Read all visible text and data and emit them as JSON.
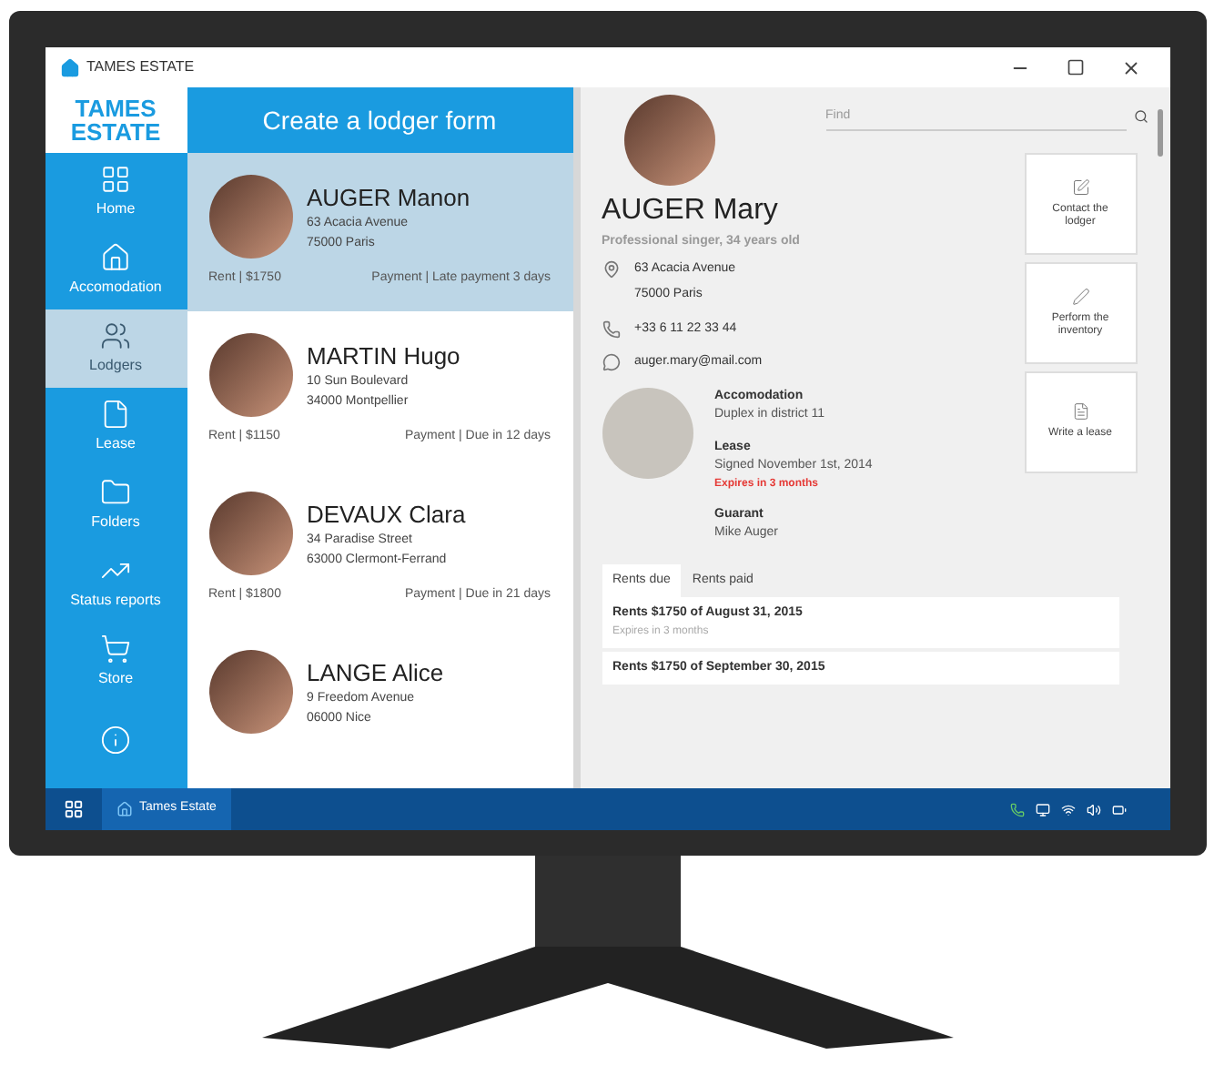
{
  "window": {
    "title": "TAMES ESTATE"
  },
  "logo": {
    "line_1": "TAMES",
    "line_2": "ESTATE"
  },
  "sidebar": {
    "items": [
      {
        "kind": "grid",
        "label": "Home",
        "selected": false
      },
      {
        "kind": "house",
        "label": "Accomodation",
        "selected": false
      },
      {
        "kind": "people",
        "label": "Lodgers",
        "selected": true
      },
      {
        "kind": "file",
        "label": "Lease",
        "selected": false
      },
      {
        "kind": "folder",
        "label": "Folders",
        "selected": false
      },
      {
        "kind": "chart",
        "label": "Status reports",
        "selected": false
      },
      {
        "kind": "cart",
        "label": "Store",
        "selected": false
      },
      {
        "kind": "info",
        "selected": false
      }
    ]
  },
  "list": {
    "header": "Create a lodger form",
    "lodgers": [
      {
        "name": "AUGER Manon",
        "address_1": "63 Acacia Avenue",
        "address_2": "75000 Paris",
        "rent": "Rent | $1750",
        "payment": "Payment | Late payment 3 days",
        "selected": true
      },
      {
        "name": "MARTIN Hugo",
        "address_1": "10 Sun Boulevard",
        "address_2": "34000 Montpellier",
        "rent": "Rent | $1150",
        "payment": "Payment | Due in 12 days",
        "selected": false
      },
      {
        "name": "DEVAUX Clara",
        "address_1": "34 Paradise Street",
        "address_2": "63000 Clermont-Ferrand",
        "rent": "Rent | $1800",
        "payment": "Payment | Due in 21 days",
        "selected": false
      },
      {
        "name": "LANGE Alice",
        "address_1": "9 Freedom Avenue",
        "address_2": "06000 Nice",
        "selected": false
      }
    ]
  },
  "detail": {
    "search": {
      "placeholder": "Find"
    },
    "name": "AUGER Mary",
    "subtitle": "Professional singer, 34 years old",
    "address_1": "63 Acacia Avenue",
    "address_2": "75000 Paris",
    "phone": "+33 6 11 22 33 44",
    "email": "auger.mary@mail.com",
    "sections": [
      {
        "title": "Accomodation",
        "lines": [
          {
            "text": "Duplex in district 11",
            "alert": false
          }
        ]
      },
      {
        "title": "Lease",
        "lines": [
          {
            "text": "Signed November 1st, 2014",
            "alert": false
          },
          {
            "text": "Expires in 3 months",
            "alert": true
          }
        ]
      },
      {
        "title": "Guarant",
        "lines": [
          {
            "text": "Mike Auger",
            "alert": false
          }
        ]
      }
    ],
    "actions": [
      {
        "kind": "edit",
        "label": "Contact the lodger"
      },
      {
        "kind": "pen",
        "label": "Perform the inventory"
      },
      {
        "kind": "doc",
        "label": "Write a lease"
      }
    ],
    "tabs": [
      {
        "label": "Rents due",
        "selected": true
      },
      {
        "label": "Rents paid",
        "selected": false
      }
    ],
    "rents": [
      {
        "title": "Rents $1750 of August 31, 2015",
        "note": "Expires in 3 months"
      },
      {
        "title": "Rents $1750 of September 30, 2015"
      }
    ]
  },
  "taskbar": {
    "app": "Tames Estate"
  }
}
